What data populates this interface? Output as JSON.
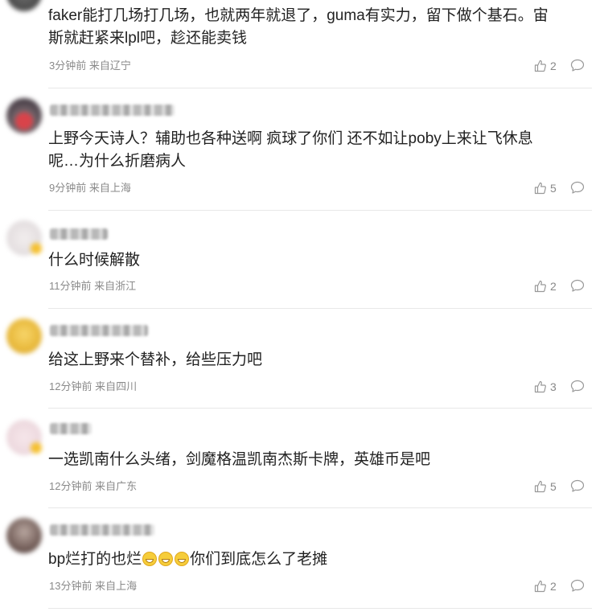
{
  "comments": [
    {
      "text_lines": [
        "faker能打几场打几场，也就两年就退了，guma有实力，留下做个基石。宙",
        "斯就赶紧来lpl吧，趁还能卖钱"
      ],
      "time": "3分钟前",
      "location": "来自辽宁",
      "likes": "2"
    },
    {
      "text_lines": [
        "上野今天诗人？辅助也各种送啊 疯球了你们 还不如让poby上来让飞休息",
        "呢…为什么折磨病人"
      ],
      "time": "9分钟前",
      "location": "来自上海",
      "likes": "5"
    },
    {
      "text_lines": [
        "什么时候解散"
      ],
      "time": "11分钟前",
      "location": "来自浙江",
      "likes": "2"
    },
    {
      "text_lines": [
        "给这上野来个替补，给些压力吧"
      ],
      "time": "12分钟前",
      "location": "来自四川",
      "likes": "3"
    },
    {
      "text_lines": [
        "一选凯南什么头绪，剑魔格温凯南杰斯卡牌，英雄币是吧"
      ],
      "time": "12分钟前",
      "location": "来自广东",
      "likes": "5"
    },
    {
      "text_parts": [
        "bp烂打的也烂",
        "你们到底怎么了老摊"
      ],
      "emoji_count": 3,
      "emoji_name": "grin-emoji",
      "time": "13分钟前",
      "location": "来自上海",
      "likes": "2"
    }
  ],
  "icons": {
    "like": "thumbs-up-icon",
    "reply": "comment-bubble-icon"
  },
  "colors": {
    "text": "#222222",
    "meta": "#8a8a8a",
    "divider": "#e8e8e8",
    "icon": "#999999"
  }
}
